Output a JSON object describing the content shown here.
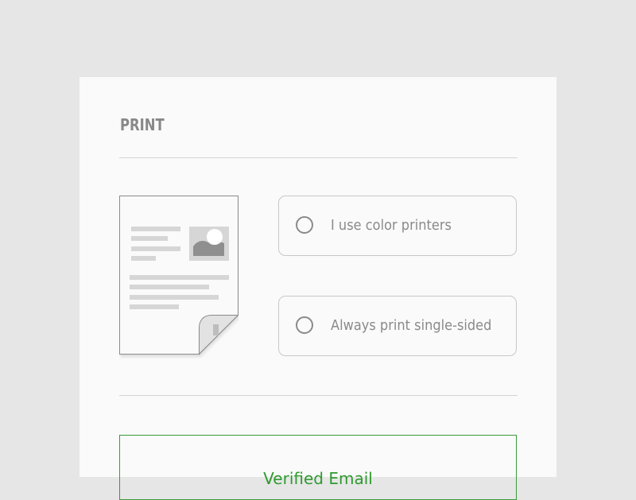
{
  "section": {
    "title": "PRINT"
  },
  "options": [
    {
      "label": "I use color printers",
      "selected": false
    },
    {
      "label": "Always print single-sided",
      "selected": false
    }
  ],
  "verified": {
    "label": "Verified Email"
  },
  "icons": {
    "document": "document-with-image-icon",
    "radio": "radio-unchecked-icon"
  },
  "colors": {
    "background": "#e6e6e6",
    "card": "#fafafa",
    "text_muted": "#888888",
    "border": "#c8c8c8",
    "accent_green": "#2e9a2e"
  }
}
